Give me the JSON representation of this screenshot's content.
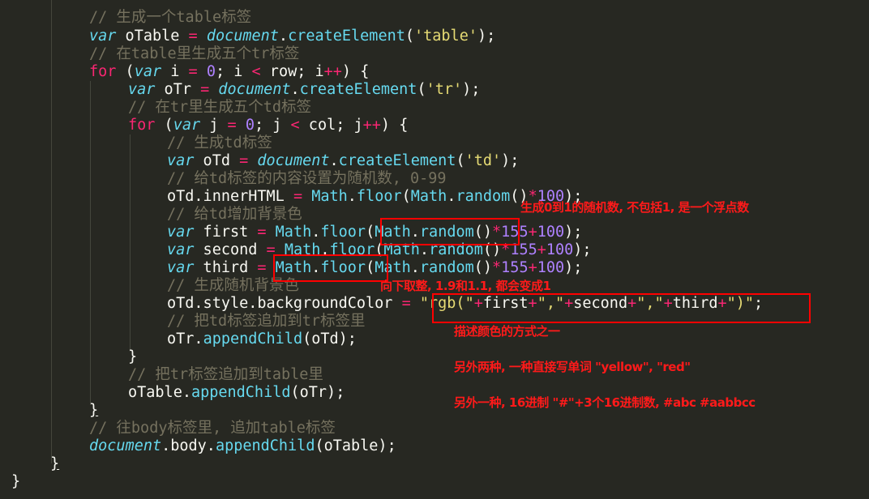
{
  "editor": {
    "lines": {
      "l0": [
        [
          "// 生成一个table标签",
          "cm"
        ]
      ],
      "l1": [
        [
          "var",
          "kw"
        ],
        [
          " oTable ",
          "pl"
        ],
        [
          "=",
          "op"
        ],
        [
          " ",
          "pl"
        ],
        [
          "document",
          "kw"
        ],
        [
          ".",
          "pl"
        ],
        [
          "createElement",
          "fn"
        ],
        [
          "(",
          "pl"
        ],
        [
          "'table'",
          "str"
        ],
        [
          ");",
          "pl"
        ]
      ],
      "l2": [
        [
          "// 在table里生成五个tr标签",
          "cm"
        ]
      ],
      "l3": [
        [
          "for",
          "kf"
        ],
        [
          " (",
          "pl"
        ],
        [
          "var",
          "kw"
        ],
        [
          " i ",
          "pl"
        ],
        [
          "=",
          "op"
        ],
        [
          " ",
          "pl"
        ],
        [
          "0",
          "num"
        ],
        [
          "; i ",
          "pl"
        ],
        [
          "<",
          "op"
        ],
        [
          " row; i",
          "pl"
        ],
        [
          "++",
          "op"
        ],
        [
          ") {",
          "pl"
        ]
      ],
      "l4": [
        [
          "var",
          "kw"
        ],
        [
          " oTr ",
          "pl"
        ],
        [
          "=",
          "op"
        ],
        [
          " ",
          "pl"
        ],
        [
          "document",
          "kw"
        ],
        [
          ".",
          "pl"
        ],
        [
          "createElement",
          "fn"
        ],
        [
          "(",
          "pl"
        ],
        [
          "'tr'",
          "str"
        ],
        [
          ");",
          "pl"
        ]
      ],
      "l5": [
        [
          "// 在tr里生成五个td标签",
          "cm"
        ]
      ],
      "l6": [
        [
          "for",
          "kf"
        ],
        [
          " (",
          "pl"
        ],
        [
          "var",
          "kw"
        ],
        [
          " j ",
          "pl"
        ],
        [
          "=",
          "op"
        ],
        [
          " ",
          "pl"
        ],
        [
          "0",
          "num"
        ],
        [
          "; j ",
          "pl"
        ],
        [
          "<",
          "op"
        ],
        [
          " col; j",
          "pl"
        ],
        [
          "++",
          "op"
        ],
        [
          ") {",
          "pl"
        ]
      ],
      "l7": [
        [
          "// 生成td标签",
          "cm"
        ]
      ],
      "l8": [
        [
          "var",
          "kw"
        ],
        [
          " oTd ",
          "pl"
        ],
        [
          "=",
          "op"
        ],
        [
          " ",
          "pl"
        ],
        [
          "document",
          "kw"
        ],
        [
          ".",
          "pl"
        ],
        [
          "createElement",
          "fn"
        ],
        [
          "(",
          "pl"
        ],
        [
          "'td'",
          "str"
        ],
        [
          ");",
          "pl"
        ]
      ],
      "l9": [
        [
          "// 给td标签的内容设置为随机数, 0-99",
          "cm"
        ]
      ],
      "l10": [
        [
          "oTd.innerHTML ",
          "pl"
        ],
        [
          "=",
          "op"
        ],
        [
          " ",
          "pl"
        ],
        [
          "Math",
          "fn"
        ],
        [
          ".",
          "pl"
        ],
        [
          "floor",
          "fn"
        ],
        [
          "(",
          "pl"
        ],
        [
          "Math",
          "fn"
        ],
        [
          ".",
          "pl"
        ],
        [
          "random",
          "fn"
        ],
        [
          "()",
          "pl"
        ],
        [
          "*",
          "op"
        ],
        [
          "100",
          "num"
        ],
        [
          ");",
          "pl"
        ]
      ],
      "l11": [
        [
          "// 给td增加背景色",
          "cm"
        ]
      ],
      "l12": [
        [
          "var",
          "kw"
        ],
        [
          " first ",
          "pl"
        ],
        [
          "=",
          "op"
        ],
        [
          " ",
          "pl"
        ],
        [
          "Math",
          "fn"
        ],
        [
          ".",
          "pl"
        ],
        [
          "floor",
          "fn"
        ],
        [
          "(",
          "pl"
        ],
        [
          "Math",
          "fn"
        ],
        [
          ".",
          "pl"
        ],
        [
          "random",
          "fn"
        ],
        [
          "()",
          "pl"
        ],
        [
          "*",
          "op"
        ],
        [
          "155",
          "num"
        ],
        [
          "+",
          "op"
        ],
        [
          "100",
          "num"
        ],
        [
          ");",
          "pl"
        ]
      ],
      "l13": [
        [
          "var",
          "kw"
        ],
        [
          " second ",
          "pl"
        ],
        [
          "=",
          "op"
        ],
        [
          " ",
          "pl"
        ],
        [
          "Math",
          "fn"
        ],
        [
          ".",
          "pl"
        ],
        [
          "floor",
          "fn"
        ],
        [
          "(",
          "pl"
        ],
        [
          "Math",
          "fn"
        ],
        [
          ".",
          "pl"
        ],
        [
          "random",
          "fn"
        ],
        [
          "()",
          "pl"
        ],
        [
          "*",
          "op"
        ],
        [
          "155",
          "num"
        ],
        [
          "+",
          "op"
        ],
        [
          "100",
          "num"
        ],
        [
          ");",
          "pl"
        ]
      ],
      "l14": [
        [
          "var",
          "kw"
        ],
        [
          " third ",
          "pl"
        ],
        [
          "=",
          "op"
        ],
        [
          " ",
          "pl"
        ],
        [
          "Math",
          "fn"
        ],
        [
          ".",
          "pl"
        ],
        [
          "floor",
          "fn"
        ],
        [
          "(",
          "pl"
        ],
        [
          "Math",
          "fn"
        ],
        [
          ".",
          "pl"
        ],
        [
          "random",
          "fn"
        ],
        [
          "()",
          "pl"
        ],
        [
          "*",
          "op"
        ],
        [
          "155",
          "num"
        ],
        [
          "+",
          "op"
        ],
        [
          "100",
          "num"
        ],
        [
          ");",
          "pl"
        ]
      ],
      "l15": [
        [
          "// 生成随机背景色",
          "cm"
        ]
      ],
      "l16": [
        [
          "oTd.style.backgroundColor ",
          "pl"
        ],
        [
          "=",
          "op"
        ],
        [
          " ",
          "pl"
        ],
        [
          "\"rgb(\"",
          "str"
        ],
        [
          "+",
          "op"
        ],
        [
          "first",
          "pl"
        ],
        [
          "+",
          "op"
        ],
        [
          "\",\"",
          "str"
        ],
        [
          "+",
          "op"
        ],
        [
          "second",
          "pl"
        ],
        [
          "+",
          "op"
        ],
        [
          "\",\"",
          "str"
        ],
        [
          "+",
          "op"
        ],
        [
          "third",
          "pl"
        ],
        [
          "+",
          "op"
        ],
        [
          "\")\"",
          "str"
        ],
        [
          ";",
          "pl"
        ]
      ],
      "l17": [
        [
          "// 把td标签追加到tr标签里",
          "cm"
        ]
      ],
      "l18": [
        [
          "oTr.",
          "pl"
        ],
        [
          "appendChild",
          "fn"
        ],
        [
          "(oTd);",
          "pl"
        ]
      ],
      "l19": [
        [
          "}",
          "pl"
        ]
      ],
      "l20": [
        [
          "// 把tr标签追加到table里",
          "cm"
        ]
      ],
      "l21": [
        [
          "oTable.",
          "pl"
        ],
        [
          "appendChild",
          "fn"
        ],
        [
          "(oTr);",
          "pl"
        ]
      ],
      "l22": [
        [
          "}",
          "pl ul"
        ]
      ],
      "l23": [
        [
          "// 往body标签里, 追加table标签",
          "cm"
        ]
      ],
      "l24": [
        [
          "document",
          "kw"
        ],
        [
          ".body.",
          "pl"
        ],
        [
          "appendChild",
          "fn"
        ],
        [
          "(oTable);",
          "pl"
        ]
      ],
      "l25": [
        [
          "}",
          "pl ul"
        ]
      ],
      "l26": [
        [
          "}",
          "pl"
        ]
      ]
    }
  },
  "annotations": {
    "random_note": "生成0到1的随机数, 不包括1, 是一个浮点数",
    "floor_note": "向下取整, 1.9和1.1, 都会变成1",
    "rgb_note": "描述颜色的方式之一",
    "named_color_note": "另外两种, 一种直接写单词 \"yellow\", \"red\"",
    "hex_note": "另外一种, 16进制 \"#\"+3个16进制数, #abc #aabbcc"
  }
}
